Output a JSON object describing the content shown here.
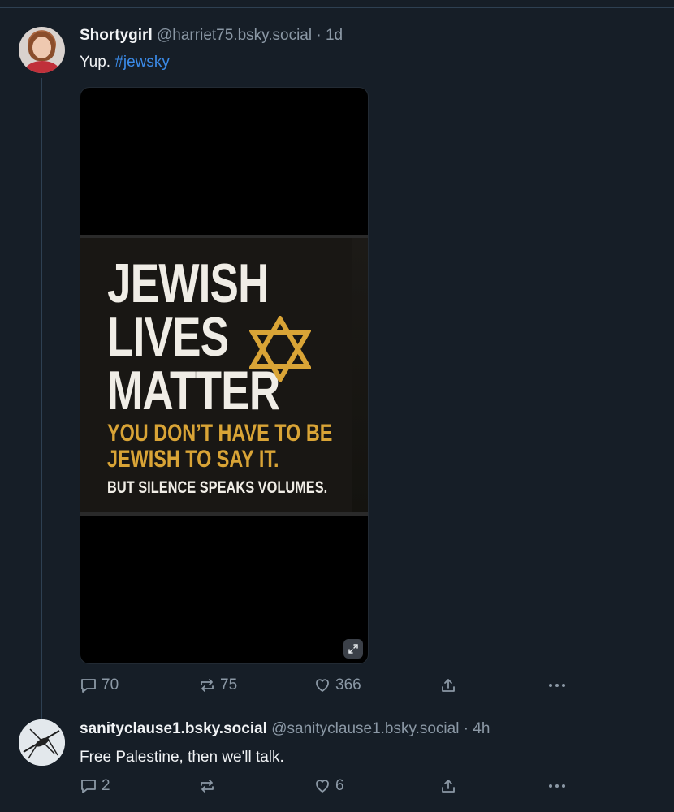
{
  "post1": {
    "display_name": "Shortygirl",
    "handle": "@harriet75.bsky.social",
    "separator": "·",
    "time": "1d",
    "text": "Yup.",
    "hashtag": "#jewsky",
    "image": {
      "line1": "JEWISH",
      "line2": "LIVES",
      "line3": "MATTER",
      "gold1": "YOU DON’T HAVE TO BE",
      "gold2": "JEWISH TO SAY IT.",
      "white_small": "BUT SILENCE SPEAKS VOLUMES."
    },
    "actions": {
      "replies": "70",
      "reposts": "75",
      "likes": "366"
    }
  },
  "post2": {
    "display_name": "sanityclause1.bsky.social",
    "handle": "@sanityclause1.bsky.social",
    "separator": "·",
    "time": "4h",
    "text": "Free Palestine, then we'll talk.",
    "actions": {
      "replies": "2",
      "reposts": "",
      "likes": "6"
    }
  },
  "icons": [
    "reply-icon",
    "repost-icon",
    "like-icon",
    "share-icon",
    "more-icon",
    "expand-icon"
  ],
  "colors": {
    "background": "#161e27",
    "link": "#3b8be8",
    "muted": "#8b98a5",
    "gold": "#d9a436"
  }
}
